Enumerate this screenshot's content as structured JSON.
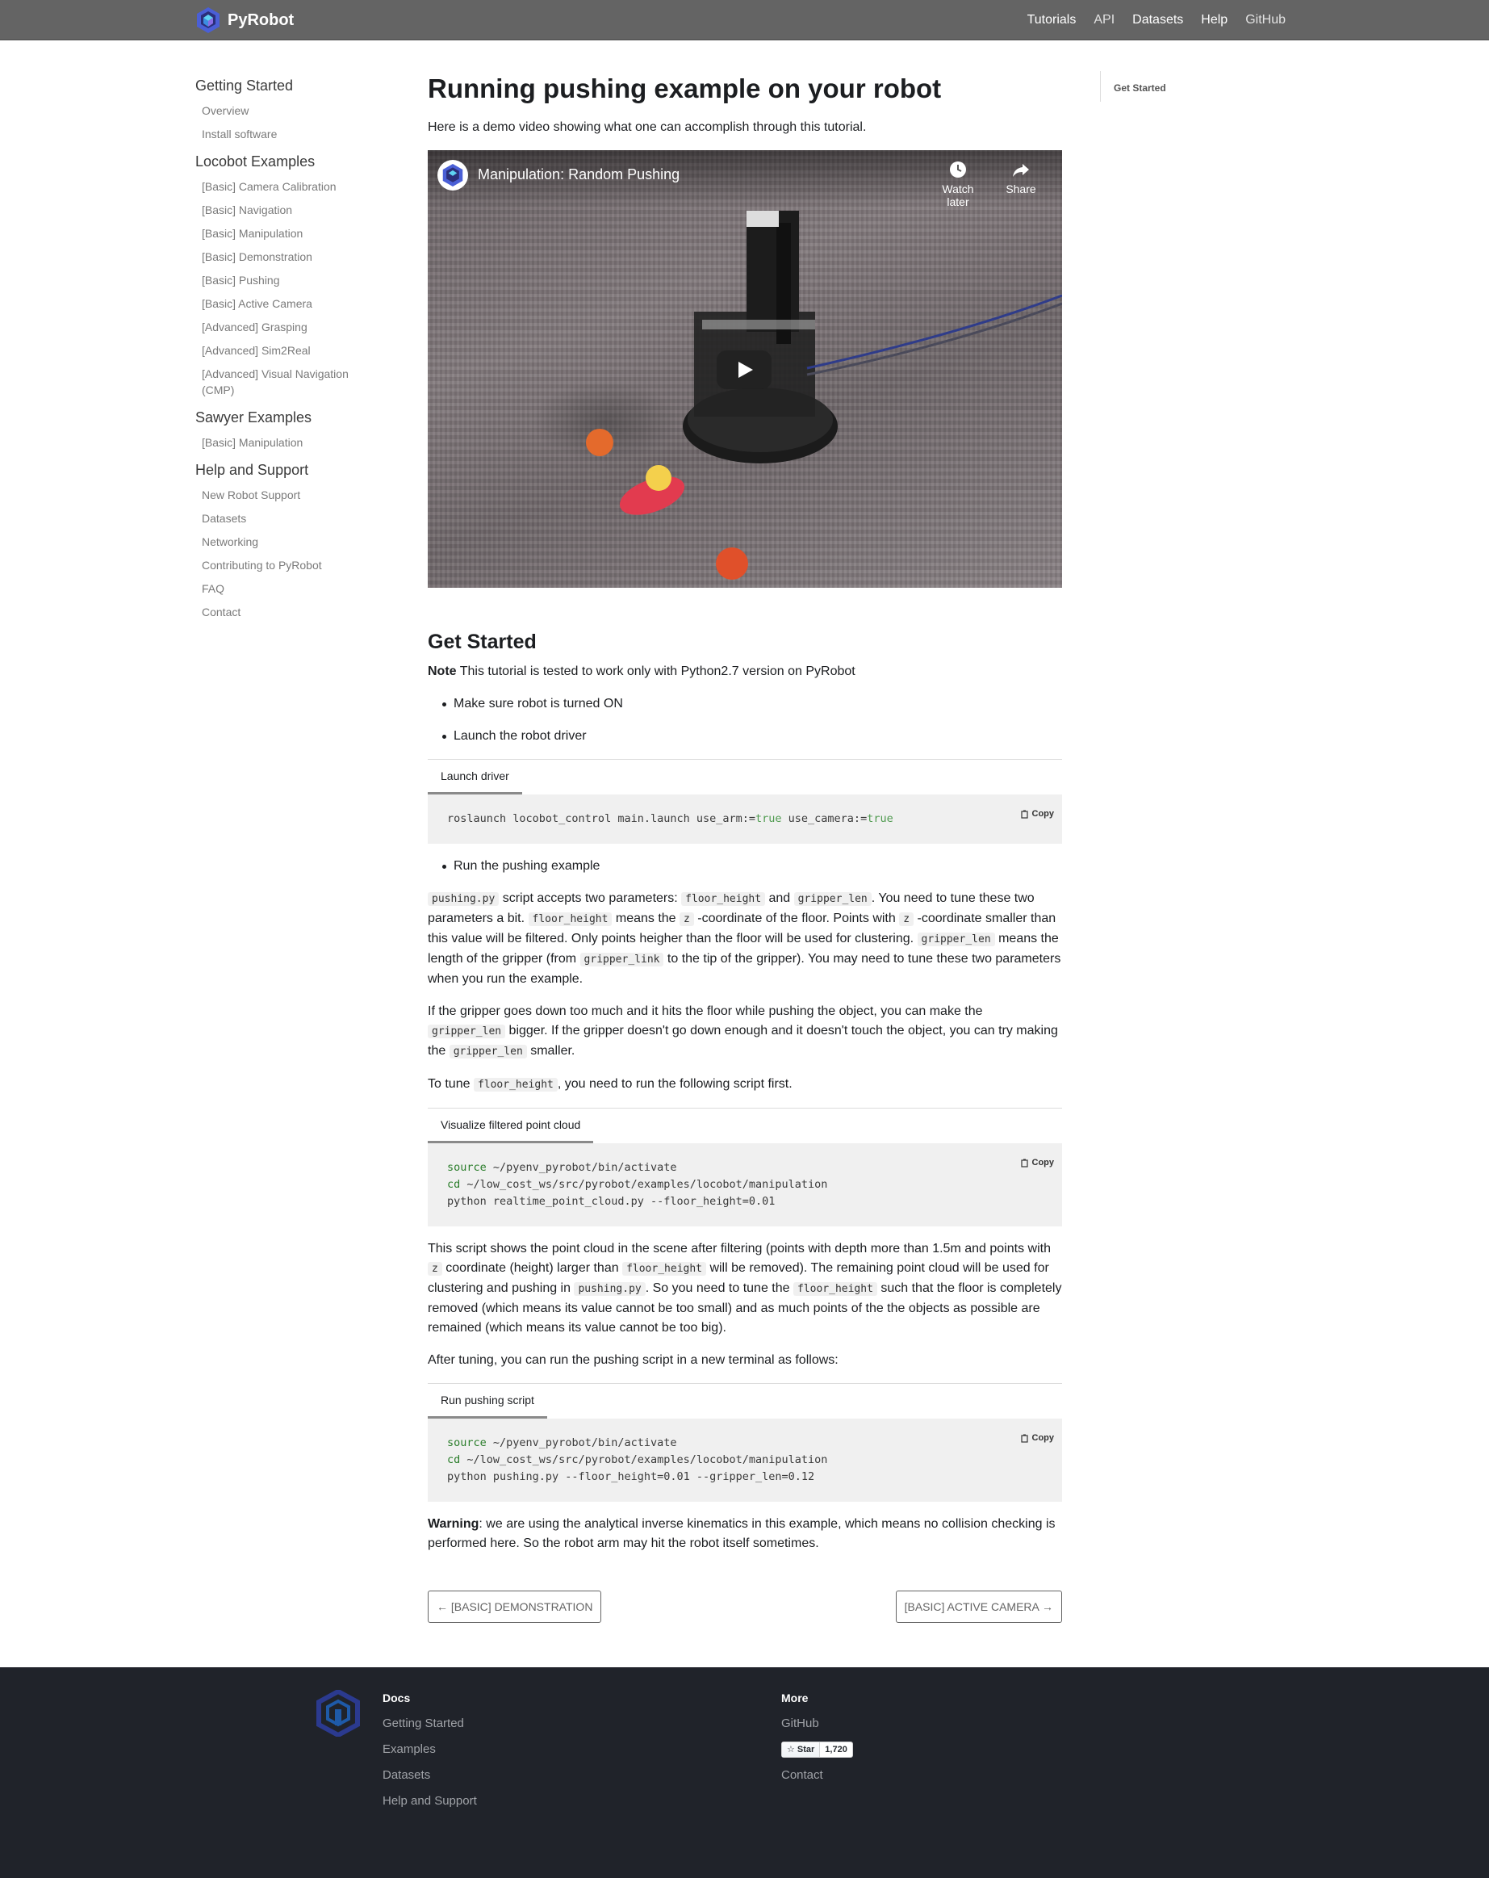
{
  "nav": {
    "brand": "PyRobot",
    "links": [
      "Tutorials",
      "API",
      "Datasets",
      "Help",
      "GitHub"
    ]
  },
  "sidebar": {
    "groups": [
      {
        "title": "Getting Started",
        "items": [
          "Overview",
          "Install software"
        ]
      },
      {
        "title": "Locobot Examples",
        "items": [
          "[Basic] Camera Calibration",
          "[Basic] Navigation",
          "[Basic] Manipulation",
          "[Basic] Demonstration",
          "[Basic] Pushing",
          "[Basic] Active Camera",
          "[Advanced] Grasping",
          "[Advanced] Sim2Real",
          "[Advanced] Visual Navigation (CMP)"
        ]
      },
      {
        "title": "Sawyer Examples",
        "items": [
          "[Basic] Manipulation"
        ]
      },
      {
        "title": "Help and Support",
        "items": [
          "New Robot Support",
          "Datasets",
          "Networking",
          "Contributing to PyRobot",
          "FAQ",
          "Contact"
        ]
      }
    ]
  },
  "toc": {
    "item": "Get Started"
  },
  "main": {
    "title": "Running pushing example on your robot",
    "intro": "Here is a demo video showing what one can accomplish through this tutorial.",
    "video": {
      "title": "Manipulation: Random Pushing",
      "watch_later": "Watch later",
      "share": "Share"
    },
    "section_title": "Get Started",
    "note_label": "Note",
    "note_text": " This tutorial is tested to work only with Python2.7 version on PyRobot",
    "bullet1": "Make sure robot is turned ON",
    "bullet2": "Launch the robot driver",
    "bullet3": "Run the pushing example",
    "copy_label": "Copy",
    "block1": {
      "tab": "Launch driver",
      "cmd": "roslaunch locobot_control main.launch use_arm:=",
      "val1": "true",
      "mid": " use_camera:=",
      "val2": "true"
    },
    "block2": {
      "tab": "Visualize filtered point cloud",
      "l1_kw": "source",
      "l1": " ~/pyenv_pyrobot/bin/activate",
      "l2_kw": "cd",
      "l2": " ~/low_cost_ws/src/pyrobot/examples/locobot/manipulation",
      "l3": "python realtime_point_cloud.py --floor_height=0.01"
    },
    "block3": {
      "tab": "Run pushing script",
      "l1_kw": "source",
      "l1": " ~/pyenv_pyrobot/bin/activate",
      "l2_kw": "cd",
      "l2": " ~/low_cost_ws/src/pyrobot/examples/locobot/manipulation",
      "l3": "python pushing.py --floor_height=0.01 --gripper_len=0.12"
    },
    "p1": {
      "c_script": "pushing.py",
      "t1": " script accepts two parameters: ",
      "c_floor": "floor_height",
      "t2": " and ",
      "c_grip": "gripper_len",
      "t3": ". You need to tune these two parameters a bit. ",
      "t4": " means the ",
      "c_z": "z",
      "t5": " -coordinate of the floor. Points with ",
      "t6": " -coordinate smaller than this value will be filtered. Only points heigher than the floor will be used for clustering. ",
      "t7": " means the length of the gripper (from ",
      "c_link": "gripper_link",
      "t8": " to the tip of the gripper). You may need to tune these two parameters when you run the example."
    },
    "p2": {
      "t1": "If the gripper goes down too much and it hits the floor while pushing the object, you can make the ",
      "t2": " bigger. If the gripper doesn't go down enough and it doesn't touch the object, you can try making the ",
      "t3": " smaller."
    },
    "p3": {
      "t1": "To tune ",
      "t2": ", you need to run the following script first."
    },
    "p4": {
      "t1": "This script shows the point cloud in the scene after filtering (points with depth more than 1.5m and points with ",
      "t2": " coordinate (height) larger than ",
      "t3": " will be removed). The remaining point cloud will be used for clustering and pushing in ",
      "t4": ". So you need to tune the ",
      "t5": " such that the floor is completely removed (which means its value cannot be too small) and as much points of the the objects as possible are remained (which means its value cannot be too big)."
    },
    "p5": "After tuning, you can run the pushing script in a new terminal as follows:",
    "warning_label": "Warning",
    "warning_text": ": we are using the analytical inverse kinematics in this example, which means no collision checking is performed here. So the robot arm may hit the robot itself sometimes.",
    "prev": "← [BASIC] DEMONSTRATION",
    "next": "[BASIC] ACTIVE CAMERA →"
  },
  "footer": {
    "docs_title": "Docs",
    "docs_links": [
      "Getting Started",
      "Examples",
      "Datasets",
      "Help and Support"
    ],
    "more_title": "More",
    "github": "GitHub",
    "star_label": "Star",
    "star_count": "1,720",
    "contact": "Contact"
  }
}
